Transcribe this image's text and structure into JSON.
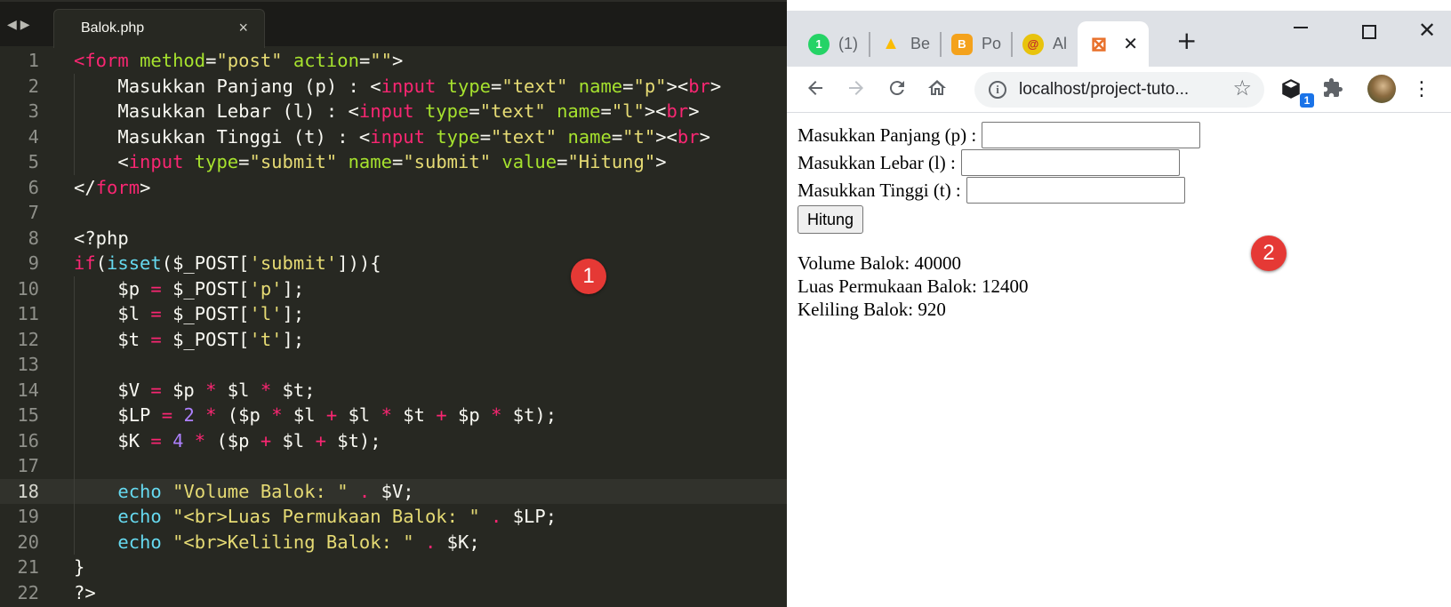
{
  "editor": {
    "tab_title": "Balok.php",
    "tab_close": "×",
    "nav_back": "◀",
    "nav_forward": "▶",
    "marker": "1",
    "active_line": 18,
    "line_numbers": [
      "1",
      "2",
      "3",
      "4",
      "5",
      "6",
      "7",
      "8",
      "9",
      "10",
      "11",
      "12",
      "13",
      "14",
      "15",
      "16",
      "17",
      "18",
      "19",
      "20",
      "21",
      "22"
    ]
  },
  "browser": {
    "tabs": [
      {
        "favicon": "1",
        "favicon_color": "#25d366",
        "title": "(1)"
      },
      {
        "favicon": "▲",
        "favicon_color": "#fbbc04",
        "title": "Be"
      },
      {
        "favicon": "B",
        "favicon_color": "#f4a21c",
        "title": "Po"
      },
      {
        "favicon": "@",
        "favicon_color": "#e8c30d",
        "title": "Al"
      },
      {
        "favicon": "⊠",
        "favicon_color": "#e8702a",
        "title": ""
      }
    ],
    "active_tab_close": "✕",
    "new_tab": "+",
    "url": "localhost/project-tuto...",
    "extension_badge": "1",
    "marker": "2"
  },
  "page": {
    "panjang_label": "Masukkan Panjang (p) :",
    "lebar_label": "Masukkan Lebar (l) :",
    "tinggi_label": "Masukkan Tinggi (t) :",
    "button_label": "Hitung",
    "volume_text": "Volume Balok: 40000",
    "luas_text": "Luas Permukaan Balok: 12400",
    "keliling_text": "Keliling Balok: 920"
  },
  "colors": {
    "editor_bg": "#272822",
    "keyword": "#f92672",
    "attribute": "#a6e22e",
    "string": "#e6db74",
    "number": "#ae81ff",
    "builtin": "#66d9ef",
    "marker": "#e53935"
  }
}
